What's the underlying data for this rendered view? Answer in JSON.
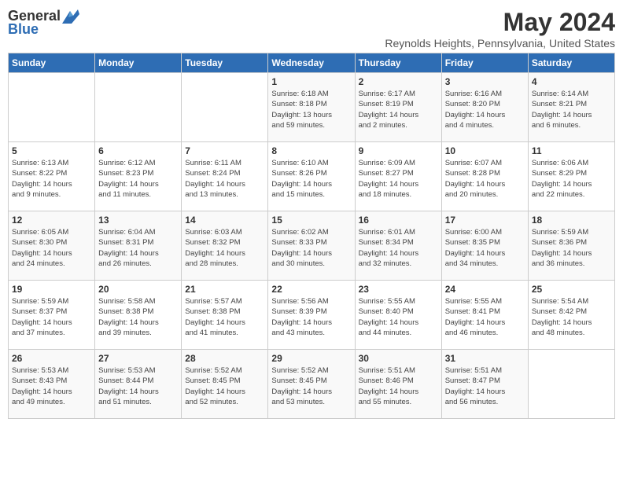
{
  "header": {
    "logo_general": "General",
    "logo_blue": "Blue",
    "month": "May 2024",
    "location": "Reynolds Heights, Pennsylvania, United States"
  },
  "days_of_week": [
    "Sunday",
    "Monday",
    "Tuesday",
    "Wednesday",
    "Thursday",
    "Friday",
    "Saturday"
  ],
  "weeks": [
    [
      {
        "day": "",
        "info": ""
      },
      {
        "day": "",
        "info": ""
      },
      {
        "day": "",
        "info": ""
      },
      {
        "day": "1",
        "info": "Sunrise: 6:18 AM\nSunset: 8:18 PM\nDaylight: 13 hours\nand 59 minutes."
      },
      {
        "day": "2",
        "info": "Sunrise: 6:17 AM\nSunset: 8:19 PM\nDaylight: 14 hours\nand 2 minutes."
      },
      {
        "day": "3",
        "info": "Sunrise: 6:16 AM\nSunset: 8:20 PM\nDaylight: 14 hours\nand 4 minutes."
      },
      {
        "day": "4",
        "info": "Sunrise: 6:14 AM\nSunset: 8:21 PM\nDaylight: 14 hours\nand 6 minutes."
      }
    ],
    [
      {
        "day": "5",
        "info": "Sunrise: 6:13 AM\nSunset: 8:22 PM\nDaylight: 14 hours\nand 9 minutes."
      },
      {
        "day": "6",
        "info": "Sunrise: 6:12 AM\nSunset: 8:23 PM\nDaylight: 14 hours\nand 11 minutes."
      },
      {
        "day": "7",
        "info": "Sunrise: 6:11 AM\nSunset: 8:24 PM\nDaylight: 14 hours\nand 13 minutes."
      },
      {
        "day": "8",
        "info": "Sunrise: 6:10 AM\nSunset: 8:26 PM\nDaylight: 14 hours\nand 15 minutes."
      },
      {
        "day": "9",
        "info": "Sunrise: 6:09 AM\nSunset: 8:27 PM\nDaylight: 14 hours\nand 18 minutes."
      },
      {
        "day": "10",
        "info": "Sunrise: 6:07 AM\nSunset: 8:28 PM\nDaylight: 14 hours\nand 20 minutes."
      },
      {
        "day": "11",
        "info": "Sunrise: 6:06 AM\nSunset: 8:29 PM\nDaylight: 14 hours\nand 22 minutes."
      }
    ],
    [
      {
        "day": "12",
        "info": "Sunrise: 6:05 AM\nSunset: 8:30 PM\nDaylight: 14 hours\nand 24 minutes."
      },
      {
        "day": "13",
        "info": "Sunrise: 6:04 AM\nSunset: 8:31 PM\nDaylight: 14 hours\nand 26 minutes."
      },
      {
        "day": "14",
        "info": "Sunrise: 6:03 AM\nSunset: 8:32 PM\nDaylight: 14 hours\nand 28 minutes."
      },
      {
        "day": "15",
        "info": "Sunrise: 6:02 AM\nSunset: 8:33 PM\nDaylight: 14 hours\nand 30 minutes."
      },
      {
        "day": "16",
        "info": "Sunrise: 6:01 AM\nSunset: 8:34 PM\nDaylight: 14 hours\nand 32 minutes."
      },
      {
        "day": "17",
        "info": "Sunrise: 6:00 AM\nSunset: 8:35 PM\nDaylight: 14 hours\nand 34 minutes."
      },
      {
        "day": "18",
        "info": "Sunrise: 5:59 AM\nSunset: 8:36 PM\nDaylight: 14 hours\nand 36 minutes."
      }
    ],
    [
      {
        "day": "19",
        "info": "Sunrise: 5:59 AM\nSunset: 8:37 PM\nDaylight: 14 hours\nand 37 minutes."
      },
      {
        "day": "20",
        "info": "Sunrise: 5:58 AM\nSunset: 8:38 PM\nDaylight: 14 hours\nand 39 minutes."
      },
      {
        "day": "21",
        "info": "Sunrise: 5:57 AM\nSunset: 8:38 PM\nDaylight: 14 hours\nand 41 minutes."
      },
      {
        "day": "22",
        "info": "Sunrise: 5:56 AM\nSunset: 8:39 PM\nDaylight: 14 hours\nand 43 minutes."
      },
      {
        "day": "23",
        "info": "Sunrise: 5:55 AM\nSunset: 8:40 PM\nDaylight: 14 hours\nand 44 minutes."
      },
      {
        "day": "24",
        "info": "Sunrise: 5:55 AM\nSunset: 8:41 PM\nDaylight: 14 hours\nand 46 minutes."
      },
      {
        "day": "25",
        "info": "Sunrise: 5:54 AM\nSunset: 8:42 PM\nDaylight: 14 hours\nand 48 minutes."
      }
    ],
    [
      {
        "day": "26",
        "info": "Sunrise: 5:53 AM\nSunset: 8:43 PM\nDaylight: 14 hours\nand 49 minutes."
      },
      {
        "day": "27",
        "info": "Sunrise: 5:53 AM\nSunset: 8:44 PM\nDaylight: 14 hours\nand 51 minutes."
      },
      {
        "day": "28",
        "info": "Sunrise: 5:52 AM\nSunset: 8:45 PM\nDaylight: 14 hours\nand 52 minutes."
      },
      {
        "day": "29",
        "info": "Sunrise: 5:52 AM\nSunset: 8:45 PM\nDaylight: 14 hours\nand 53 minutes."
      },
      {
        "day": "30",
        "info": "Sunrise: 5:51 AM\nSunset: 8:46 PM\nDaylight: 14 hours\nand 55 minutes."
      },
      {
        "day": "31",
        "info": "Sunrise: 5:51 AM\nSunset: 8:47 PM\nDaylight: 14 hours\nand 56 minutes."
      },
      {
        "day": "",
        "info": ""
      }
    ]
  ]
}
